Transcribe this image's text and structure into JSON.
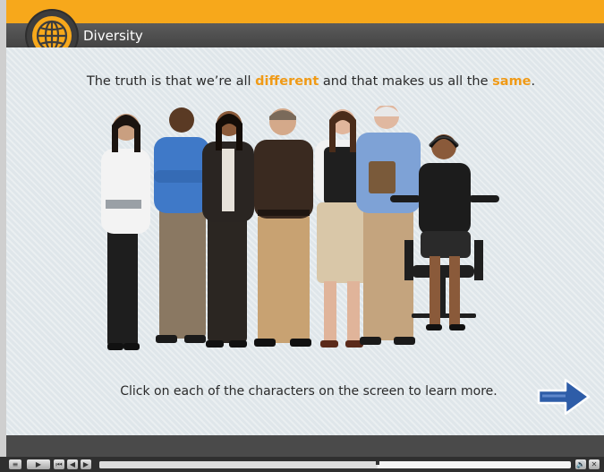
{
  "header": {
    "title": "Diversity",
    "badge_icon": "globe-icon"
  },
  "content": {
    "headline_before": "The truth is that we’re all ",
    "headline_word1": "different",
    "headline_middle": " and that makes us all the ",
    "headline_word2": "same",
    "headline_after": ".",
    "instruction": "Click on each of the characters  on the screen to learn more.",
    "characters": [
      "character-1",
      "character-2",
      "character-3",
      "character-4",
      "character-5",
      "character-6",
      "character-7"
    ],
    "next_icon": "right-arrow-icon"
  },
  "player": {
    "buttons": [
      "menu-icon",
      "play-icon",
      "rewind-icon",
      "previous-icon",
      "next-icon"
    ],
    "progress_fraction": 0.59,
    "right_buttons": [
      "volume-icon",
      "close-icon"
    ]
  },
  "colors": {
    "accent": "#f7a81b",
    "highlight_text": "#f09a16",
    "arrow": "#2e5da8",
    "title_bar": "#4f4f4f",
    "stage": "#dfe6ea"
  }
}
